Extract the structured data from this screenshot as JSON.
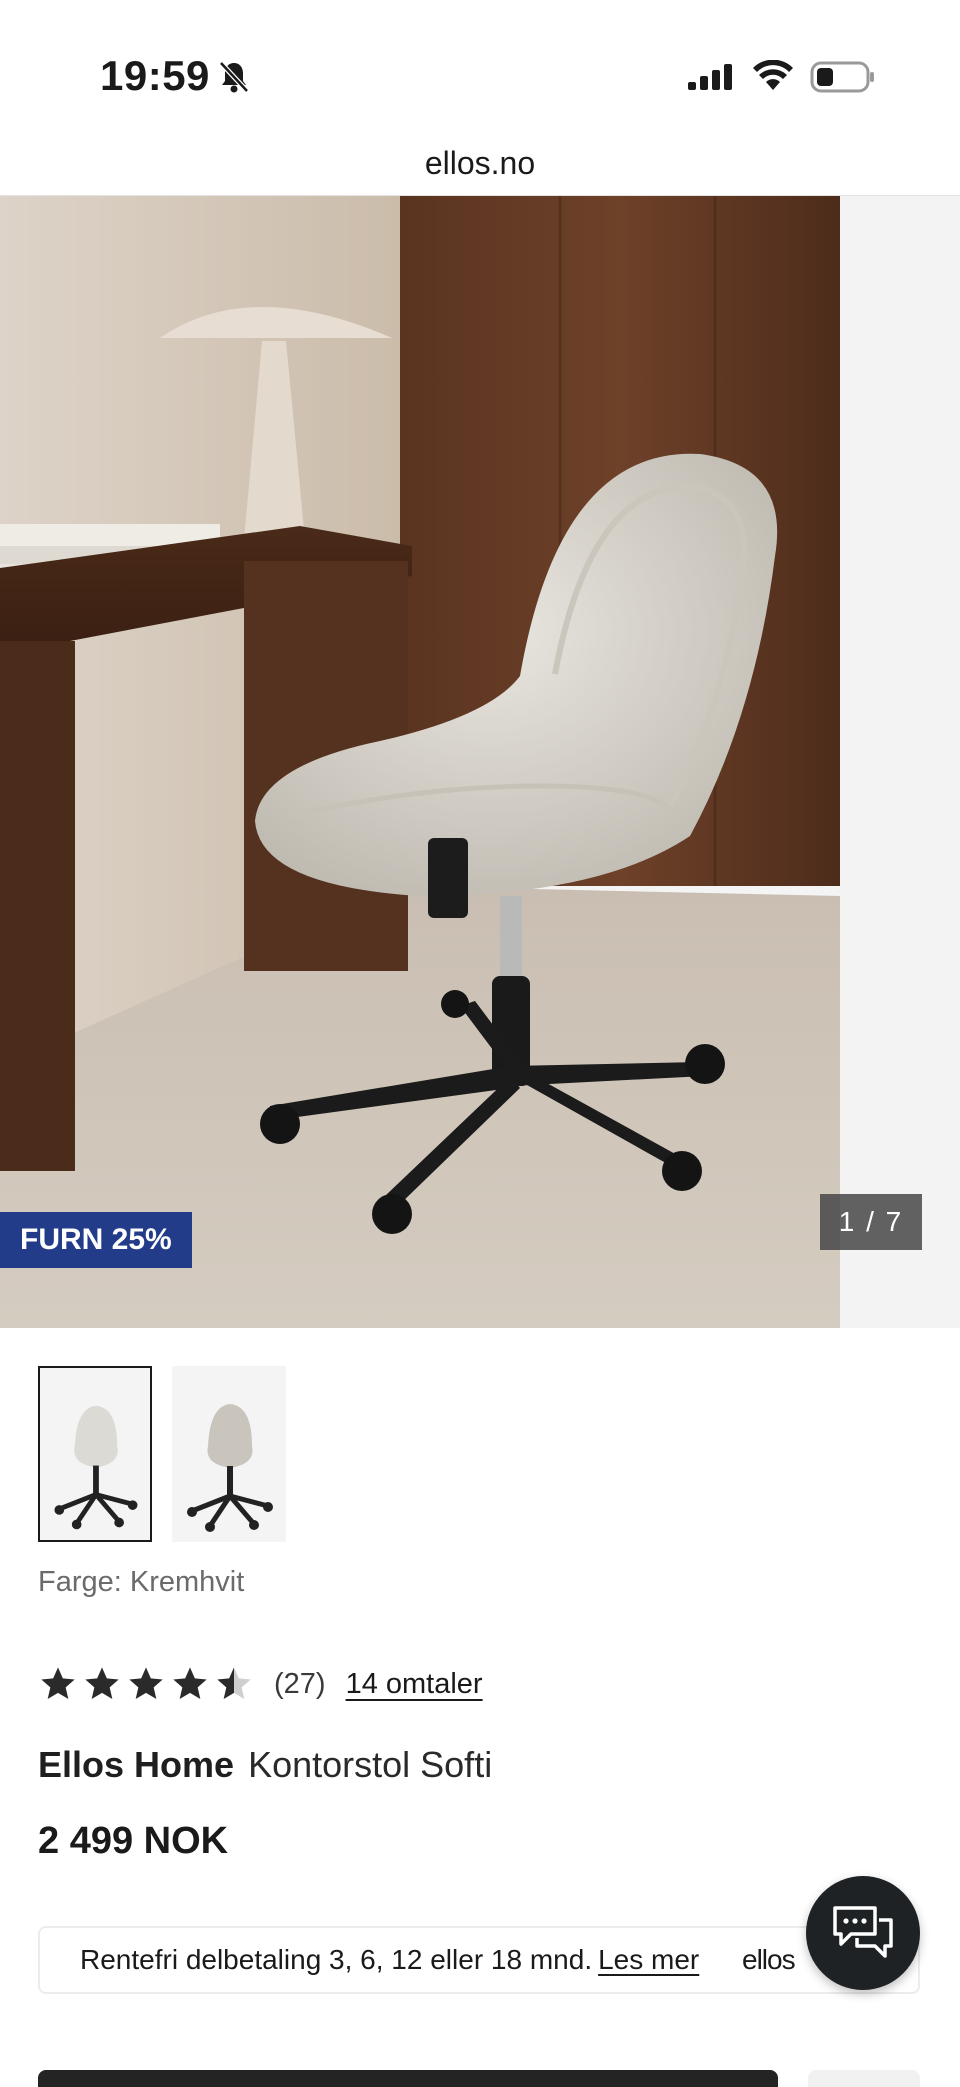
{
  "status_bar": {
    "time": "19:59",
    "icons": [
      "bell-slash-icon",
      "cellular-signal-icon",
      "wifi-icon",
      "battery-icon"
    ]
  },
  "browser": {
    "url": "ellos.no"
  },
  "gallery": {
    "badge": "FURN 25%",
    "counter": "1 / 7",
    "badge_color": "#223c8a"
  },
  "thumbnails": [
    {
      "label": "",
      "active": true
    },
    {
      "label": "",
      "active": false
    }
  ],
  "product": {
    "color_label": "Farge: Kremhvit",
    "rating_value": 4.5,
    "rating_max": 5,
    "review_count": "(27)",
    "reviews_link": "14 omtaler",
    "brand": "Ellos Home",
    "name": "Kontorstol Softi",
    "price": "2 499 NOK"
  },
  "payment": {
    "text": "Rentefri delbetaling 3, 6, 12 eller 18 mnd.",
    "link": "Les mer",
    "logo": "ellos"
  },
  "chat": {
    "icon": "chat-bubbles-icon"
  }
}
